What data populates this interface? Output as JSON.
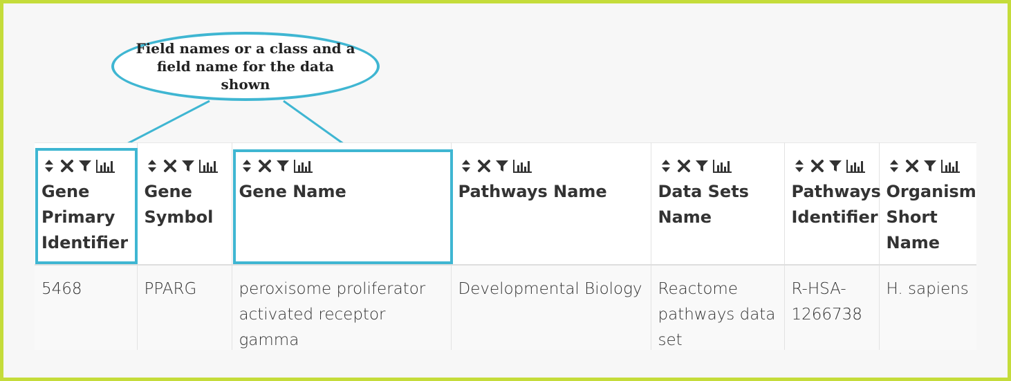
{
  "callout": {
    "text": "Field names or a class and a field name for the data shown"
  },
  "table": {
    "columns": [
      {
        "label": "Gene Primary Identifier"
      },
      {
        "label": "Gene Symbol"
      },
      {
        "label": "Gene Name"
      },
      {
        "label": "Pathways Name"
      },
      {
        "label": "Data Sets Name"
      },
      {
        "label": "Pathways Identifier"
      },
      {
        "label": "Organism Short Name"
      }
    ],
    "rows": [
      [
        "5468",
        "PPARG",
        "peroxisome proliferator activated receptor gamma",
        "Developmental Biology",
        "Reactome pathways data set",
        "R-HSA-1266738",
        "H. sapiens"
      ]
    ],
    "column_tools": [
      "sort-icon",
      "remove-column-icon",
      "filter-icon",
      "column-summary-icon"
    ]
  },
  "colors": {
    "frame_border": "#c5dc3a",
    "highlight": "#3fb6d2",
    "background": "#f7f7f7"
  }
}
